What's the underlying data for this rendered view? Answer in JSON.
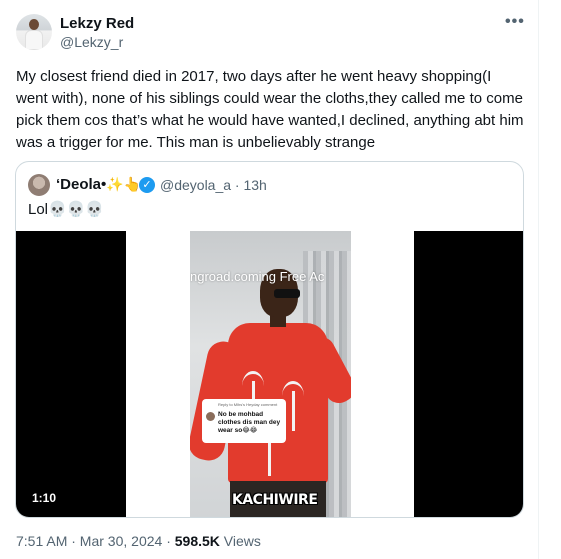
{
  "tweet": {
    "author_name": "Lekzy Red",
    "author_handle": "@Lekzy_r",
    "more_icon": "•••",
    "text": "My closest friend died in 2017, two days after he went heavy shopping(I went with), none of his siblings could wear the cloths,they called me to come pick them cos that’s what he would have wanted,I declined, anything abt him was a trigger for me. This man is unbelievably strange",
    "timestamp": "7:51 AM · Mar 30, 2024",
    "separator": " · ",
    "views_count": "598.5K",
    "views_label": " Views"
  },
  "quoted_tweet": {
    "author_name": "‘Deola•",
    "author_emoji": "✨👆",
    "verified_mark": "✓",
    "author_handle": "@deyola_a · 13h",
    "text": "Lol💀💀💀",
    "video": {
      "watermark": "ngroad.coming Free Ac",
      "comment_meta": "Reply to Mlhs's Heyday comment",
      "comment_text": "No be mohbad clothes dis man dey wear so😂😂",
      "caption": "KACHIWIRE",
      "duration": "1:10"
    }
  },
  "colors": {
    "text_primary": "#0f1419",
    "text_secondary": "#536471",
    "border": "#cfd9de",
    "verified": "#1d9bf0",
    "shirt_red": "#e23b2d"
  },
  "icons": {
    "more": "more-horizontal-icon",
    "verified": "verified-badge-icon"
  }
}
